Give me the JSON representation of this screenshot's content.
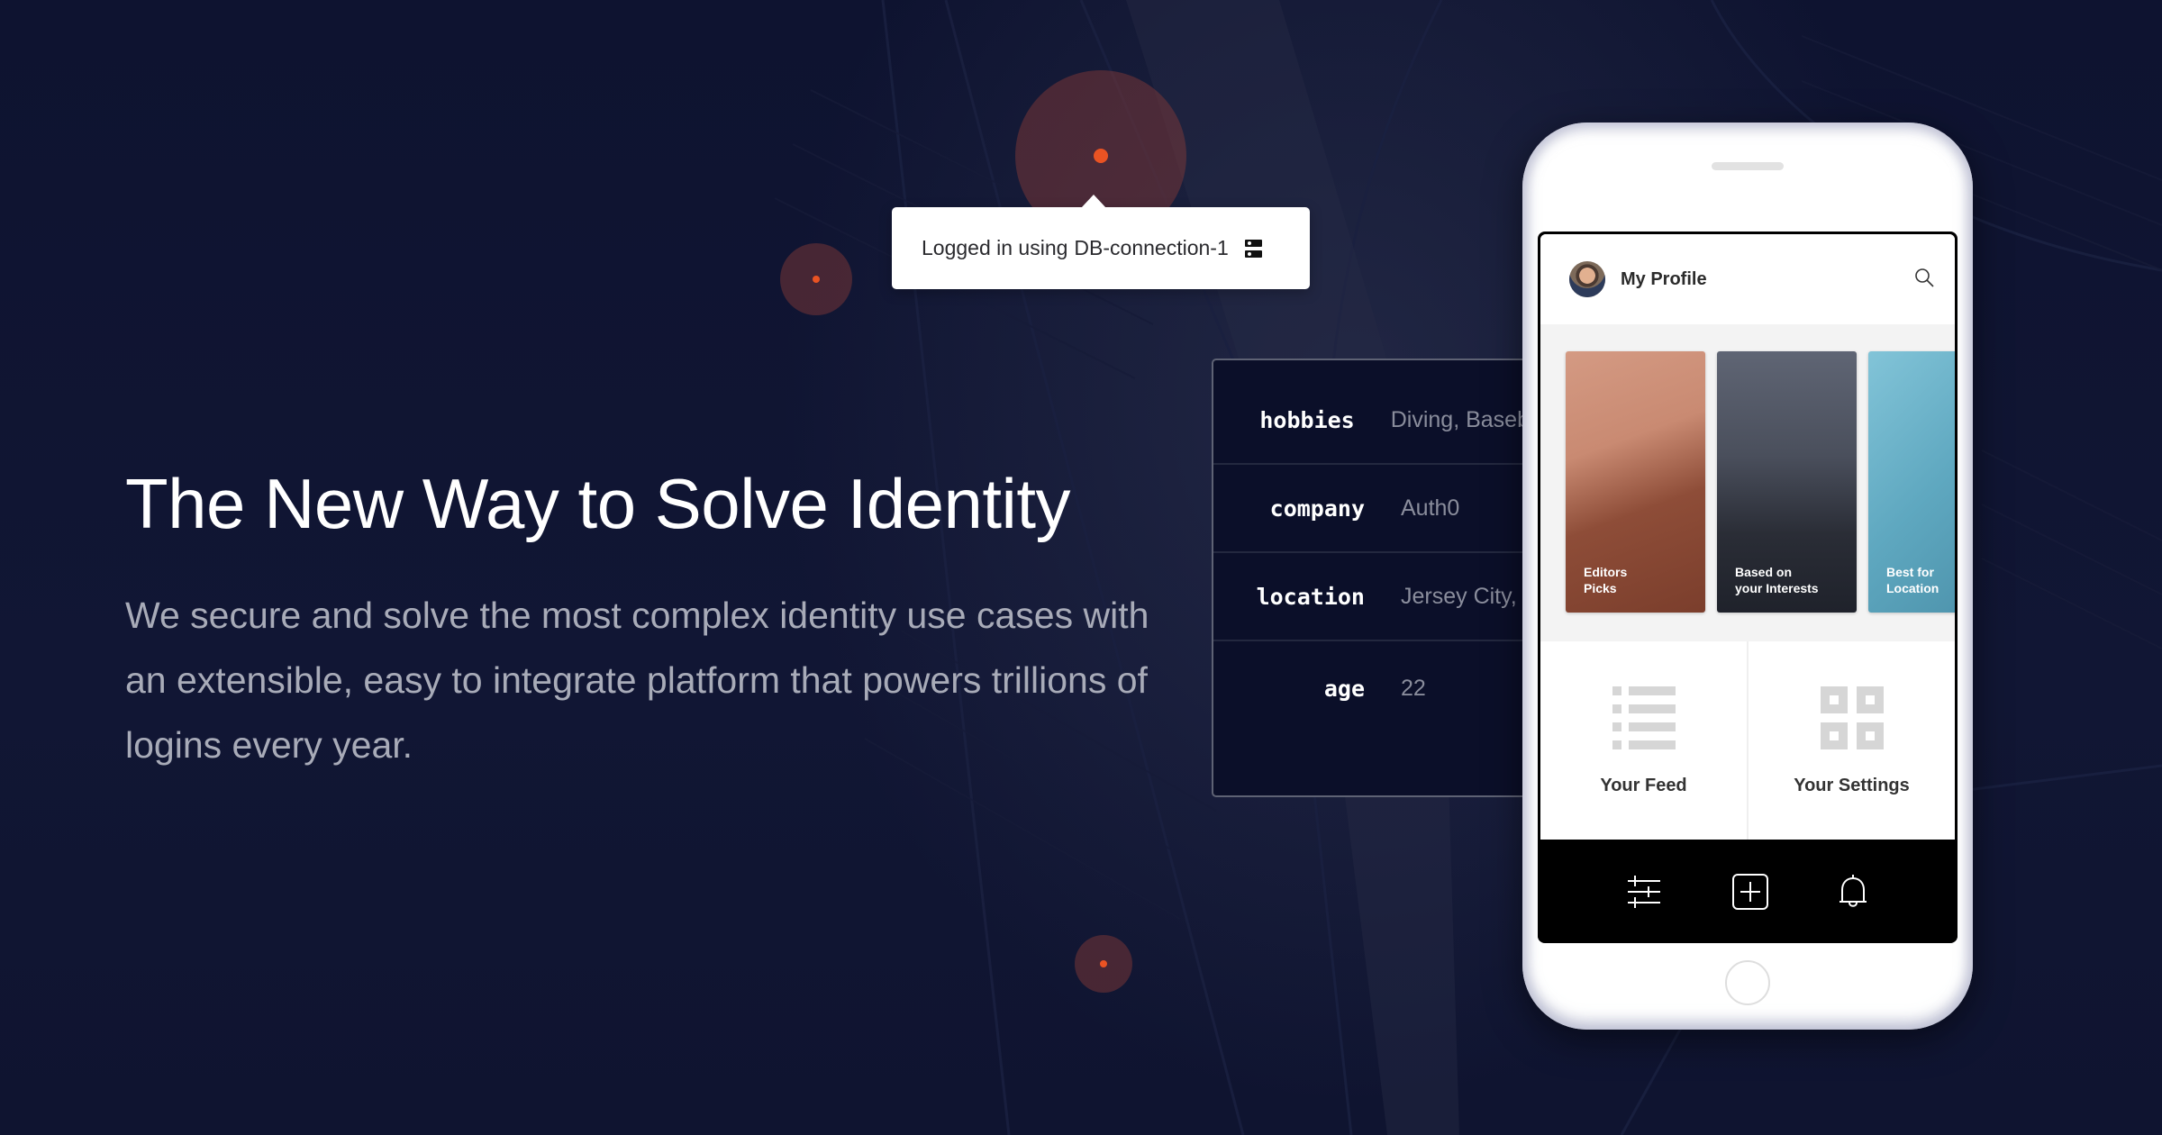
{
  "hero": {
    "title": "The New Way to Solve Identity",
    "description": "We secure and solve the most complex identity use cases with an extensible, easy to integrate platform that powers trillions of logins every year."
  },
  "tooltip": {
    "prefix": "Logged in using",
    "connection": "DB-connection-1",
    "icon": "database-server-icon"
  },
  "colors": {
    "accent": "#ea5323",
    "background": "#0f1430",
    "card_bg": "#0b0f29"
  },
  "profile_card": {
    "rows": [
      {
        "key": "hobbies",
        "value": "Diving, Baseball"
      },
      {
        "key": "company",
        "value": "Auth0"
      },
      {
        "key": "location",
        "value": "Jersey City, NJ"
      },
      {
        "key": "age",
        "value": "22"
      }
    ]
  },
  "phone": {
    "header": {
      "title": "My Profile",
      "avatar": "user-avatar",
      "search_icon": "search-icon"
    },
    "cards": [
      {
        "label_line1": "Editors",
        "label_line2": "Picks"
      },
      {
        "label_line1": "Based on",
        "label_line2": "your Interests"
      },
      {
        "label_line1": "Best for",
        "label_line2": "Location"
      }
    ],
    "tiles": [
      {
        "label": "Your Feed",
        "icon": "list-icon"
      },
      {
        "label": "Your Settings",
        "icon": "grid-icon"
      }
    ],
    "tabbar": [
      {
        "icon": "sliders-icon"
      },
      {
        "icon": "add-square-icon"
      },
      {
        "icon": "bell-icon"
      }
    ]
  }
}
